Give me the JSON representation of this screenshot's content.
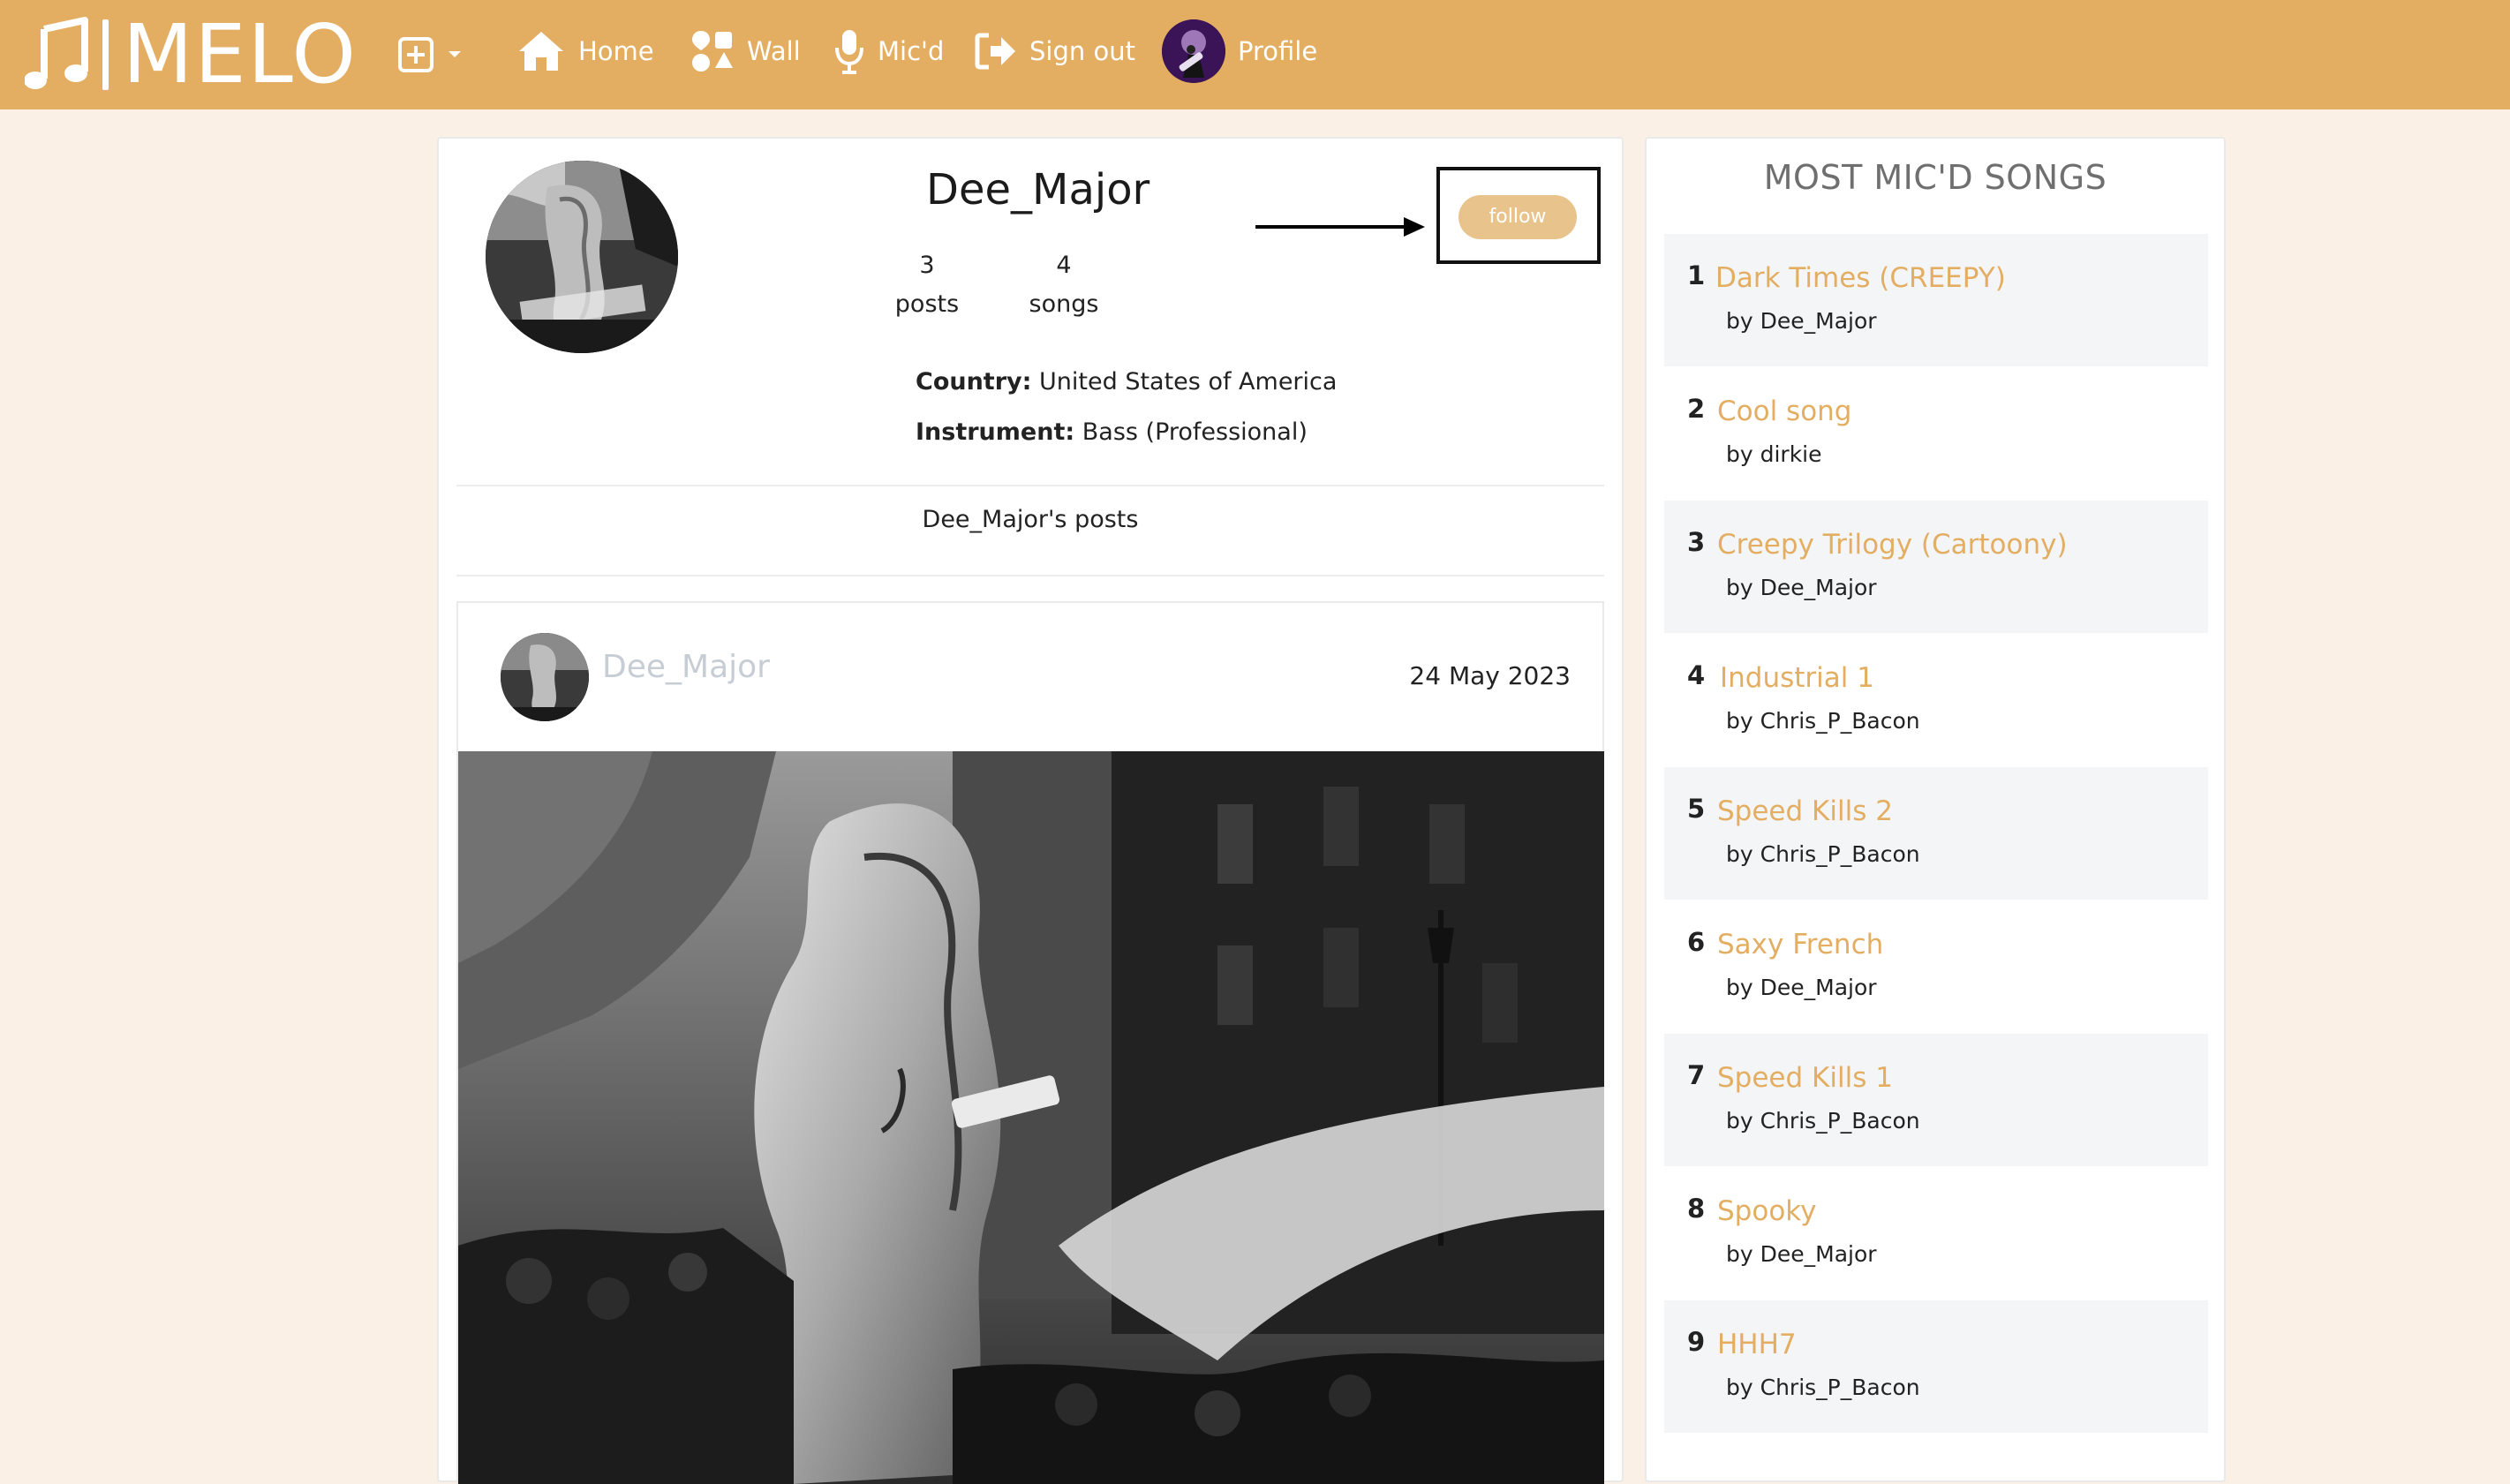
{
  "brand": {
    "name": "MELO"
  },
  "nav": {
    "items": [
      {
        "label": "Home",
        "icon": "home-icon"
      },
      {
        "label": "Wall",
        "icon": "shapes-icon"
      },
      {
        "label": "Mic'd",
        "icon": "microphone-icon"
      },
      {
        "label": "Sign out",
        "icon": "sign-out-icon"
      },
      {
        "label": "Profile",
        "icon": "avatar"
      }
    ],
    "create_icon": "plus-square-icon",
    "dropdown_icon": "caret-down-icon"
  },
  "profile": {
    "username": "Dee_Major",
    "posts_count": "3",
    "posts_label": "posts",
    "songs_count": "4",
    "songs_label": "songs",
    "country_label": "Country:",
    "country": "United States of America",
    "instrument_label": "Instrument:",
    "instrument": "Bass (Professional)",
    "follow_label": "follow",
    "posts_heading": "Dee_Major's posts"
  },
  "post": {
    "author": "Dee_Major",
    "date": "24 May 2023"
  },
  "sidebar": {
    "title": "MOST MIC'D SONGS",
    "songs": [
      {
        "rank": "1",
        "title": "Dark Times (CREEPY)",
        "by": "by Dee_Major"
      },
      {
        "rank": "2",
        "title": "Cool song",
        "by": "by dirkie"
      },
      {
        "rank": "3",
        "title": "Creepy Trilogy (Cartoony)",
        "by": "by Dee_Major"
      },
      {
        "rank": "4",
        "title": "Industrial 1",
        "by": "by Chris_P_Bacon"
      },
      {
        "rank": "5",
        "title": "Speed Kills 2",
        "by": "by Chris_P_Bacon"
      },
      {
        "rank": "6",
        "title": "Saxy French",
        "by": "by Dee_Major"
      },
      {
        "rank": "7",
        "title": "Speed Kills 1",
        "by": "by Chris_P_Bacon"
      },
      {
        "rank": "8",
        "title": "Spooky",
        "by": "by Dee_Major"
      },
      {
        "rank": "9",
        "title": "HHH7",
        "by": "by Chris_P_Bacon"
      }
    ]
  },
  "colors": {
    "navbar": "#e3ae62",
    "page_bg": "#fbf0e6",
    "accent": "#e3ae62",
    "follow_button": "#e8c38c"
  }
}
